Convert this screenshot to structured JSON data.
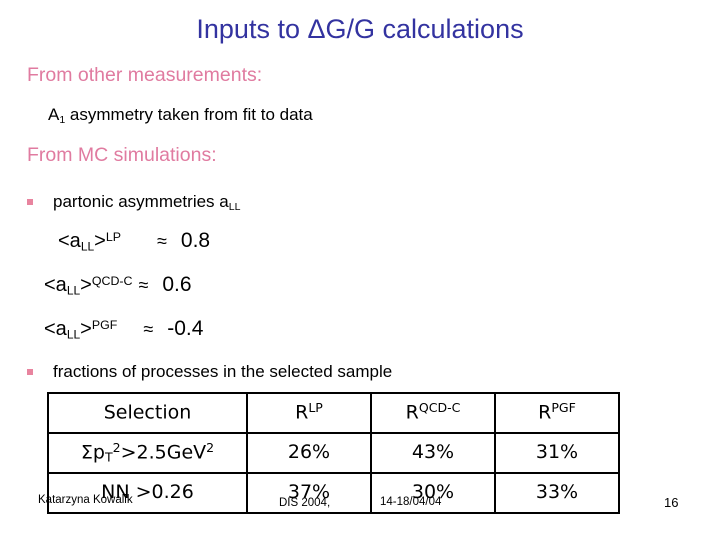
{
  "slide": {
    "title": "Inputs to ΔG/G calculations",
    "title_color": "#3333a0",
    "accent_color": "#e07ba0",
    "sections": {
      "from_other": {
        "heading": "From other measurements:",
        "items": [
          {
            "prefix": "A",
            "subscript": "1",
            "text": " asymmetry taken from fit to  data"
          }
        ]
      },
      "from_mc": {
        "heading": "From MC simulations:",
        "bullets": [
          {
            "label_prefix": "partonic asymmetries a",
            "label_subscript": "LL"
          },
          {
            "label_prefix": "fractions of processes in the selected sample",
            "label_subscript": ""
          }
        ]
      }
    },
    "asymmetries": [
      {
        "open": "<a",
        "sub": "LL",
        "close": ">",
        "sup": "LP",
        "relation": "≈",
        "value": "0.8"
      },
      {
        "open": "<a",
        "sub": "LL",
        "close": ">",
        "sup": "QCD-C",
        "relation": "≈",
        "value": "0.6"
      },
      {
        "open": "<a",
        "sub": "LL",
        "close": ">",
        "sup": "PGF",
        "relation": "≈",
        "value": "-0.4"
      }
    ],
    "table": {
      "headers": [
        {
          "base": "Selection",
          "sup": ""
        },
        {
          "base": "R",
          "sup": "LP"
        },
        {
          "base": "R",
          "sup": "QCD-C"
        },
        {
          "base": "R",
          "sup": "PGF"
        }
      ],
      "rows": [
        {
          "selection": {
            "sigma": "Σp",
            "sub": "T",
            "sup": "2",
            "rest": ">2.5GeV",
            "rest_sup": "2"
          },
          "values": [
            "26%",
            "43%",
            "31%"
          ]
        },
        {
          "selection": {
            "sigma": "NN >0.26",
            "sub": "",
            "sup": "",
            "rest": "",
            "rest_sup": ""
          },
          "values": [
            "37%",
            "30%",
            "33%"
          ]
        }
      ]
    },
    "footer": {
      "author": "Katarzyna Kowalik",
      "conference": "DIS 2004,",
      "date": "14-18/04/04",
      "page_number": "16"
    }
  }
}
